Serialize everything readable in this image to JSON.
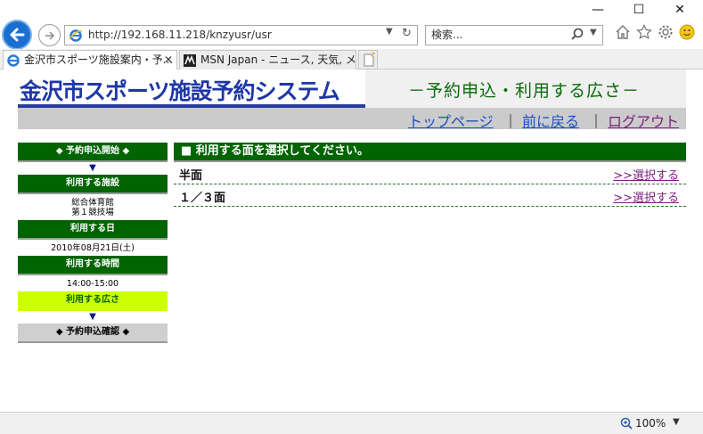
{
  "window": {
    "min": "—",
    "max": "☐",
    "close": "✕"
  },
  "address": {
    "url": "http://192.168.11.218/knzyusr/usr"
  },
  "search": {
    "placeholder": "検索..."
  },
  "tabs": [
    {
      "label": "金沢市スポーツ施設案内・予...",
      "close": "✕"
    },
    {
      "label": "MSN Japan - ニュース, 天気, メー..."
    }
  ],
  "banner": {
    "logo": "金沢市スポーツ施設予約システム",
    "subtitle": "－予約申込・利用する広さ－"
  },
  "toplinks": {
    "top": "トップページ",
    "back": "前に戻る",
    "logout": "ログアウト",
    "sep": "｜"
  },
  "steps": {
    "start": "◆ 予約申込開始 ◆",
    "facility_header": "利用する施設",
    "facility_value": [
      "総合体育館",
      "第１競技場"
    ],
    "date_header": "利用する日",
    "date_value": "2010年08月21日(土)",
    "time_header": "利用する時間",
    "time_value": "14:00-15:00",
    "size_header": "利用する広さ",
    "confirm": "◆ 予約申込確認 ◆",
    "arrow": "▼"
  },
  "main": {
    "header": "■ 利用する面を選択してください。",
    "options": [
      {
        "label": "半面",
        "link": ">>選択する"
      },
      {
        "label": "１／３面",
        "link": ">>選択する"
      }
    ]
  },
  "status": {
    "zoom": "100%"
  },
  "colors": {
    "accent": "#006400",
    "current_step": "#ccff00",
    "logo": "#1f37a6"
  }
}
